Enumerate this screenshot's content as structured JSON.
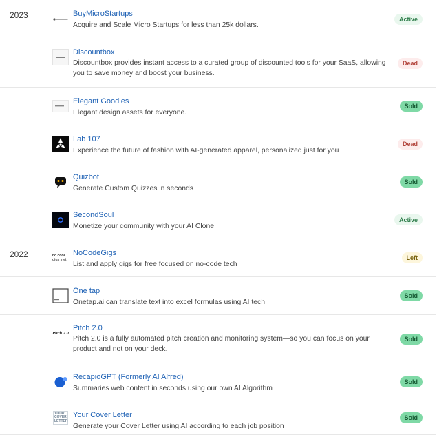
{
  "years": [
    "2023",
    "2022"
  ],
  "projects": [
    {
      "year": "2023",
      "name": "BuyMicroStartups",
      "description": "Acquire and Scale Micro Startups for less than 25k dollars.",
      "status": "Active",
      "icon": "buymicrostartups-logo"
    },
    {
      "year": "2023",
      "name": "Discountbox",
      "description": "Discountbox provides instant access to a curated group of discounted tools for your SaaS, allowing you to save money and boost your business.",
      "status": "Dead",
      "icon": "discountbox-logo"
    },
    {
      "year": "2023",
      "name": "Elegant Goodies",
      "description": "Elegant design assets for everyone.",
      "status": "Sold",
      "icon": "elegant-goodies-logo"
    },
    {
      "year": "2023",
      "name": "Lab 107",
      "description": "Experience the future of fashion with AI-generated apparel, personalized just for you",
      "status": "Dead",
      "icon": "lab107-logo"
    },
    {
      "year": "2023",
      "name": "Quizbot",
      "description": "Generate Custom Quizzes in seconds",
      "status": "Sold",
      "icon": "quizbot-logo"
    },
    {
      "year": "2023",
      "name": "SecondSoul",
      "description": "Monetize your community with your AI Clone",
      "status": "Active",
      "icon": "secondsoul-logo"
    },
    {
      "year": "2022",
      "name": "NoCodeGigs",
      "description": "List and apply gigs for free focused on no-code tech",
      "status": "Left",
      "icon": "nocodegigs-logo",
      "logo_text": [
        "no code",
        "gigs .net"
      ]
    },
    {
      "year": "2022",
      "name": "One tap",
      "description": "Onetap.ai can translate text into excel formulas using AI tech",
      "status": "Sold",
      "icon": "onetap-logo"
    },
    {
      "year": "2022",
      "name": "Pitch 2.0",
      "description": "Pitch 2.0 is a fully automated pitch creation and monitoring system—so you can focus on your product and not on your deck.",
      "status": "Sold",
      "icon": "pitch-logo",
      "logo_text": [
        "Pitch 2.0"
      ]
    },
    {
      "year": "2022",
      "name": "RecapioGPT (Formerly AI Alfred)",
      "description": "Summaries web content in seconds using our own AI Algorithm",
      "status": "Sold",
      "icon": "recapio-logo"
    },
    {
      "year": "2022",
      "name": "Your Cover Letter",
      "description": "Generate your Cover Letter using AI according to each job position",
      "status": "Sold",
      "icon": "yourcoverletter-logo",
      "logo_text": [
        "YOUR COVER LETTER"
      ]
    }
  ],
  "colors": {
    "link": "#1f62b5",
    "sold_badge": "#7fd9a6",
    "active_badge": "#e9f7ee",
    "dead_badge": "#fdecec",
    "left_badge": "#fdf6dc"
  }
}
